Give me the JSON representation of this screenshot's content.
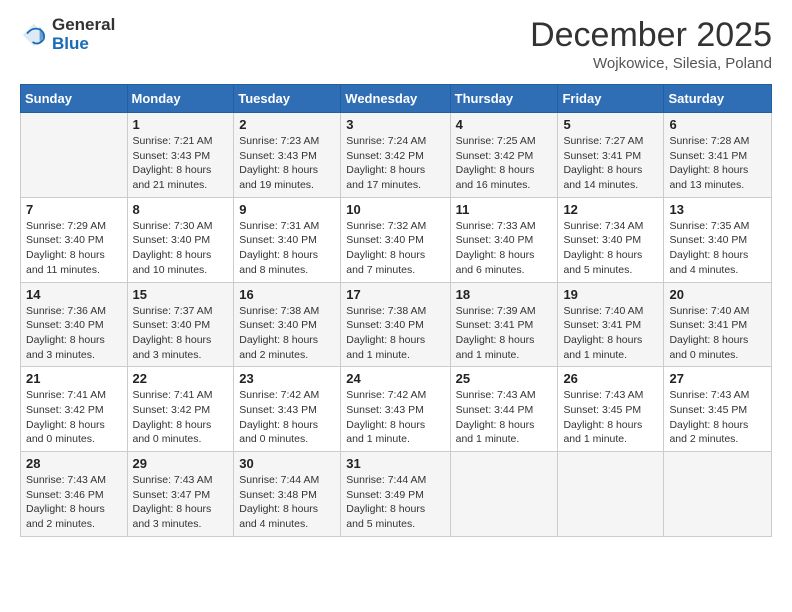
{
  "logo": {
    "general": "General",
    "blue": "Blue"
  },
  "header": {
    "month": "December 2025",
    "location": "Wojkowice, Silesia, Poland"
  },
  "weekdays": [
    "Sunday",
    "Monday",
    "Tuesday",
    "Wednesday",
    "Thursday",
    "Friday",
    "Saturday"
  ],
  "weeks": [
    [
      {
        "day": "",
        "sunrise": "",
        "sunset": "",
        "daylight": ""
      },
      {
        "day": "1",
        "sunrise": "Sunrise: 7:21 AM",
        "sunset": "Sunset: 3:43 PM",
        "daylight": "Daylight: 8 hours and 21 minutes."
      },
      {
        "day": "2",
        "sunrise": "Sunrise: 7:23 AM",
        "sunset": "Sunset: 3:43 PM",
        "daylight": "Daylight: 8 hours and 19 minutes."
      },
      {
        "day": "3",
        "sunrise": "Sunrise: 7:24 AM",
        "sunset": "Sunset: 3:42 PM",
        "daylight": "Daylight: 8 hours and 17 minutes."
      },
      {
        "day": "4",
        "sunrise": "Sunrise: 7:25 AM",
        "sunset": "Sunset: 3:42 PM",
        "daylight": "Daylight: 8 hours and 16 minutes."
      },
      {
        "day": "5",
        "sunrise": "Sunrise: 7:27 AM",
        "sunset": "Sunset: 3:41 PM",
        "daylight": "Daylight: 8 hours and 14 minutes."
      },
      {
        "day": "6",
        "sunrise": "Sunrise: 7:28 AM",
        "sunset": "Sunset: 3:41 PM",
        "daylight": "Daylight: 8 hours and 13 minutes."
      }
    ],
    [
      {
        "day": "7",
        "sunrise": "Sunrise: 7:29 AM",
        "sunset": "Sunset: 3:40 PM",
        "daylight": "Daylight: 8 hours and 11 minutes."
      },
      {
        "day": "8",
        "sunrise": "Sunrise: 7:30 AM",
        "sunset": "Sunset: 3:40 PM",
        "daylight": "Daylight: 8 hours and 10 minutes."
      },
      {
        "day": "9",
        "sunrise": "Sunrise: 7:31 AM",
        "sunset": "Sunset: 3:40 PM",
        "daylight": "Daylight: 8 hours and 8 minutes."
      },
      {
        "day": "10",
        "sunrise": "Sunrise: 7:32 AM",
        "sunset": "Sunset: 3:40 PM",
        "daylight": "Daylight: 8 hours and 7 minutes."
      },
      {
        "day": "11",
        "sunrise": "Sunrise: 7:33 AM",
        "sunset": "Sunset: 3:40 PM",
        "daylight": "Daylight: 8 hours and 6 minutes."
      },
      {
        "day": "12",
        "sunrise": "Sunrise: 7:34 AM",
        "sunset": "Sunset: 3:40 PM",
        "daylight": "Daylight: 8 hours and 5 minutes."
      },
      {
        "day": "13",
        "sunrise": "Sunrise: 7:35 AM",
        "sunset": "Sunset: 3:40 PM",
        "daylight": "Daylight: 8 hours and 4 minutes."
      }
    ],
    [
      {
        "day": "14",
        "sunrise": "Sunrise: 7:36 AM",
        "sunset": "Sunset: 3:40 PM",
        "daylight": "Daylight: 8 hours and 3 minutes."
      },
      {
        "day": "15",
        "sunrise": "Sunrise: 7:37 AM",
        "sunset": "Sunset: 3:40 PM",
        "daylight": "Daylight: 8 hours and 3 minutes."
      },
      {
        "day": "16",
        "sunrise": "Sunrise: 7:38 AM",
        "sunset": "Sunset: 3:40 PM",
        "daylight": "Daylight: 8 hours and 2 minutes."
      },
      {
        "day": "17",
        "sunrise": "Sunrise: 7:38 AM",
        "sunset": "Sunset: 3:40 PM",
        "daylight": "Daylight: 8 hours and 1 minute."
      },
      {
        "day": "18",
        "sunrise": "Sunrise: 7:39 AM",
        "sunset": "Sunset: 3:41 PM",
        "daylight": "Daylight: 8 hours and 1 minute."
      },
      {
        "day": "19",
        "sunrise": "Sunrise: 7:40 AM",
        "sunset": "Sunset: 3:41 PM",
        "daylight": "Daylight: 8 hours and 1 minute."
      },
      {
        "day": "20",
        "sunrise": "Sunrise: 7:40 AM",
        "sunset": "Sunset: 3:41 PM",
        "daylight": "Daylight: 8 hours and 0 minutes."
      }
    ],
    [
      {
        "day": "21",
        "sunrise": "Sunrise: 7:41 AM",
        "sunset": "Sunset: 3:42 PM",
        "daylight": "Daylight: 8 hours and 0 minutes."
      },
      {
        "day": "22",
        "sunrise": "Sunrise: 7:41 AM",
        "sunset": "Sunset: 3:42 PM",
        "daylight": "Daylight: 8 hours and 0 minutes."
      },
      {
        "day": "23",
        "sunrise": "Sunrise: 7:42 AM",
        "sunset": "Sunset: 3:43 PM",
        "daylight": "Daylight: 8 hours and 0 minutes."
      },
      {
        "day": "24",
        "sunrise": "Sunrise: 7:42 AM",
        "sunset": "Sunset: 3:43 PM",
        "daylight": "Daylight: 8 hours and 1 minute."
      },
      {
        "day": "25",
        "sunrise": "Sunrise: 7:43 AM",
        "sunset": "Sunset: 3:44 PM",
        "daylight": "Daylight: 8 hours and 1 minute."
      },
      {
        "day": "26",
        "sunrise": "Sunrise: 7:43 AM",
        "sunset": "Sunset: 3:45 PM",
        "daylight": "Daylight: 8 hours and 1 minute."
      },
      {
        "day": "27",
        "sunrise": "Sunrise: 7:43 AM",
        "sunset": "Sunset: 3:45 PM",
        "daylight": "Daylight: 8 hours and 2 minutes."
      }
    ],
    [
      {
        "day": "28",
        "sunrise": "Sunrise: 7:43 AM",
        "sunset": "Sunset: 3:46 PM",
        "daylight": "Daylight: 8 hours and 2 minutes."
      },
      {
        "day": "29",
        "sunrise": "Sunrise: 7:43 AM",
        "sunset": "Sunset: 3:47 PM",
        "daylight": "Daylight: 8 hours and 3 minutes."
      },
      {
        "day": "30",
        "sunrise": "Sunrise: 7:44 AM",
        "sunset": "Sunset: 3:48 PM",
        "daylight": "Daylight: 8 hours and 4 minutes."
      },
      {
        "day": "31",
        "sunrise": "Sunrise: 7:44 AM",
        "sunset": "Sunset: 3:49 PM",
        "daylight": "Daylight: 8 hours and 5 minutes."
      },
      {
        "day": "",
        "sunrise": "",
        "sunset": "",
        "daylight": ""
      },
      {
        "day": "",
        "sunrise": "",
        "sunset": "",
        "daylight": ""
      },
      {
        "day": "",
        "sunrise": "",
        "sunset": "",
        "daylight": ""
      }
    ]
  ]
}
